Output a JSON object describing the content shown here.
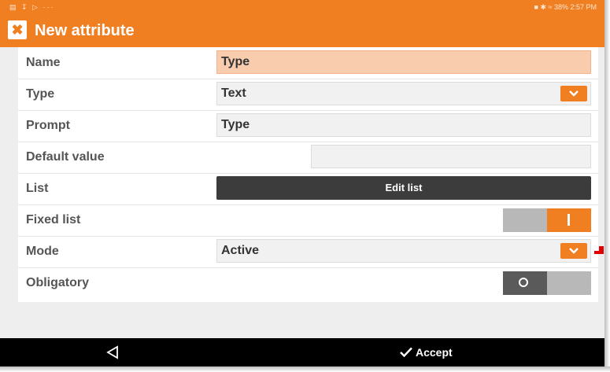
{
  "status_bar": {
    "right_text": "38% 2:57 PM"
  },
  "app_bar": {
    "title": "New attribute"
  },
  "form": {
    "name": {
      "label": "Name",
      "value": "Type"
    },
    "type": {
      "label": "Type",
      "value": "Text"
    },
    "prompt": {
      "label": "Prompt",
      "value": "Type"
    },
    "default_value": {
      "label": "Default value",
      "value": ""
    },
    "list": {
      "label": "List",
      "button_label": "Edit list"
    },
    "fixed_list": {
      "label": "Fixed list",
      "enabled": true
    },
    "mode": {
      "label": "Mode",
      "value": "Active"
    },
    "obligatory": {
      "label": "Obligatory",
      "enabled": false
    }
  },
  "nav_bar": {
    "accept_label": "Accept"
  },
  "colors": {
    "accent": "#f07f22",
    "name_field": "#f9ccad",
    "edit_button": "#3c3c3c"
  }
}
